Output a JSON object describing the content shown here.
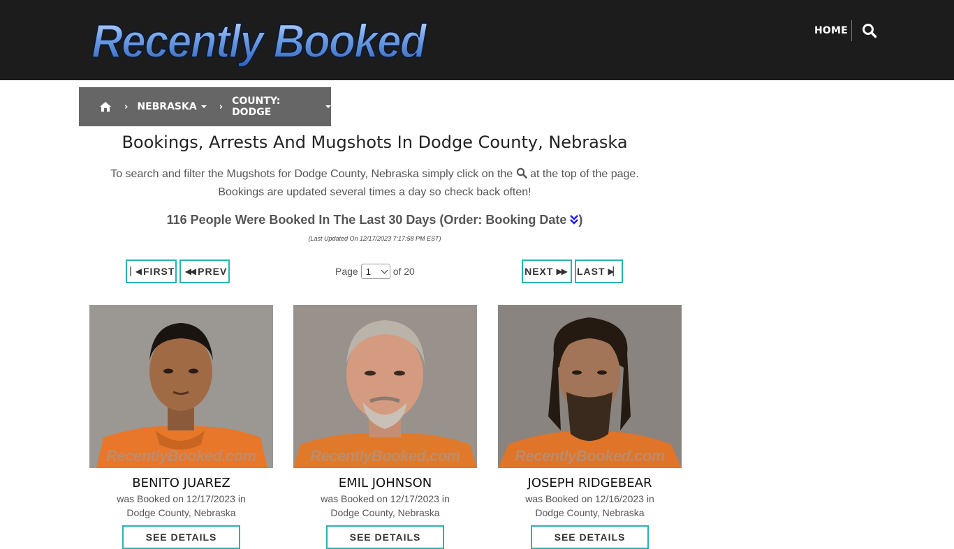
{
  "header": {
    "logo_text": "Recently Booked",
    "nav_home": "HOME",
    "search_icon": "search-icon"
  },
  "breadcrumb": {
    "home_icon": "home-icon",
    "state": "NEBRASKA",
    "county": "COUNTY: DODGE"
  },
  "main": {
    "title": "Bookings, Arrests And Mugshots In Dodge County, Nebraska",
    "intro_before_icon": "To search and filter the Mugshots for Dodge County, Nebraska simply click on the",
    "intro_after_icon": "at the top of the page.",
    "intro_line2": "Bookings are updated several times a day so check back often!",
    "booked_count": "116 People Were Booked In The Last 30 Days (Order: Booking Date",
    "booked_count_close": ")",
    "last_updated": "(Last Updated On 12/17/2023 7:17:58 PM EST)"
  },
  "pagination": {
    "first": "FIRST",
    "prev": "PREV",
    "next": "NEXT",
    "last": "LAST",
    "page_label": "Page",
    "current_page": "1",
    "of_label": "of 20"
  },
  "watermark": "RecentlyBooked.com",
  "people": [
    {
      "name": "BENITO JUAREZ",
      "booked_line": "was Booked on 12/17/2023 in",
      "location": "Dodge County, Nebraska",
      "details": "SEE DETAILS"
    },
    {
      "name": "EMIL JOHNSON",
      "booked_line": "was Booked on 12/17/2023 in",
      "location": "Dodge County, Nebraska",
      "details": "SEE DETAILS"
    },
    {
      "name": "JOSEPH RIDGEBEAR",
      "booked_line": "was Booked on 12/16/2023 in",
      "location": "Dodge County, Nebraska",
      "details": "SEE DETAILS"
    }
  ],
  "colors": {
    "header_bg": "#1c1c1c",
    "breadcrumb_bg": "#666666",
    "accent_border": "#27b3b3",
    "logo_blue": "#5b8fd8"
  }
}
